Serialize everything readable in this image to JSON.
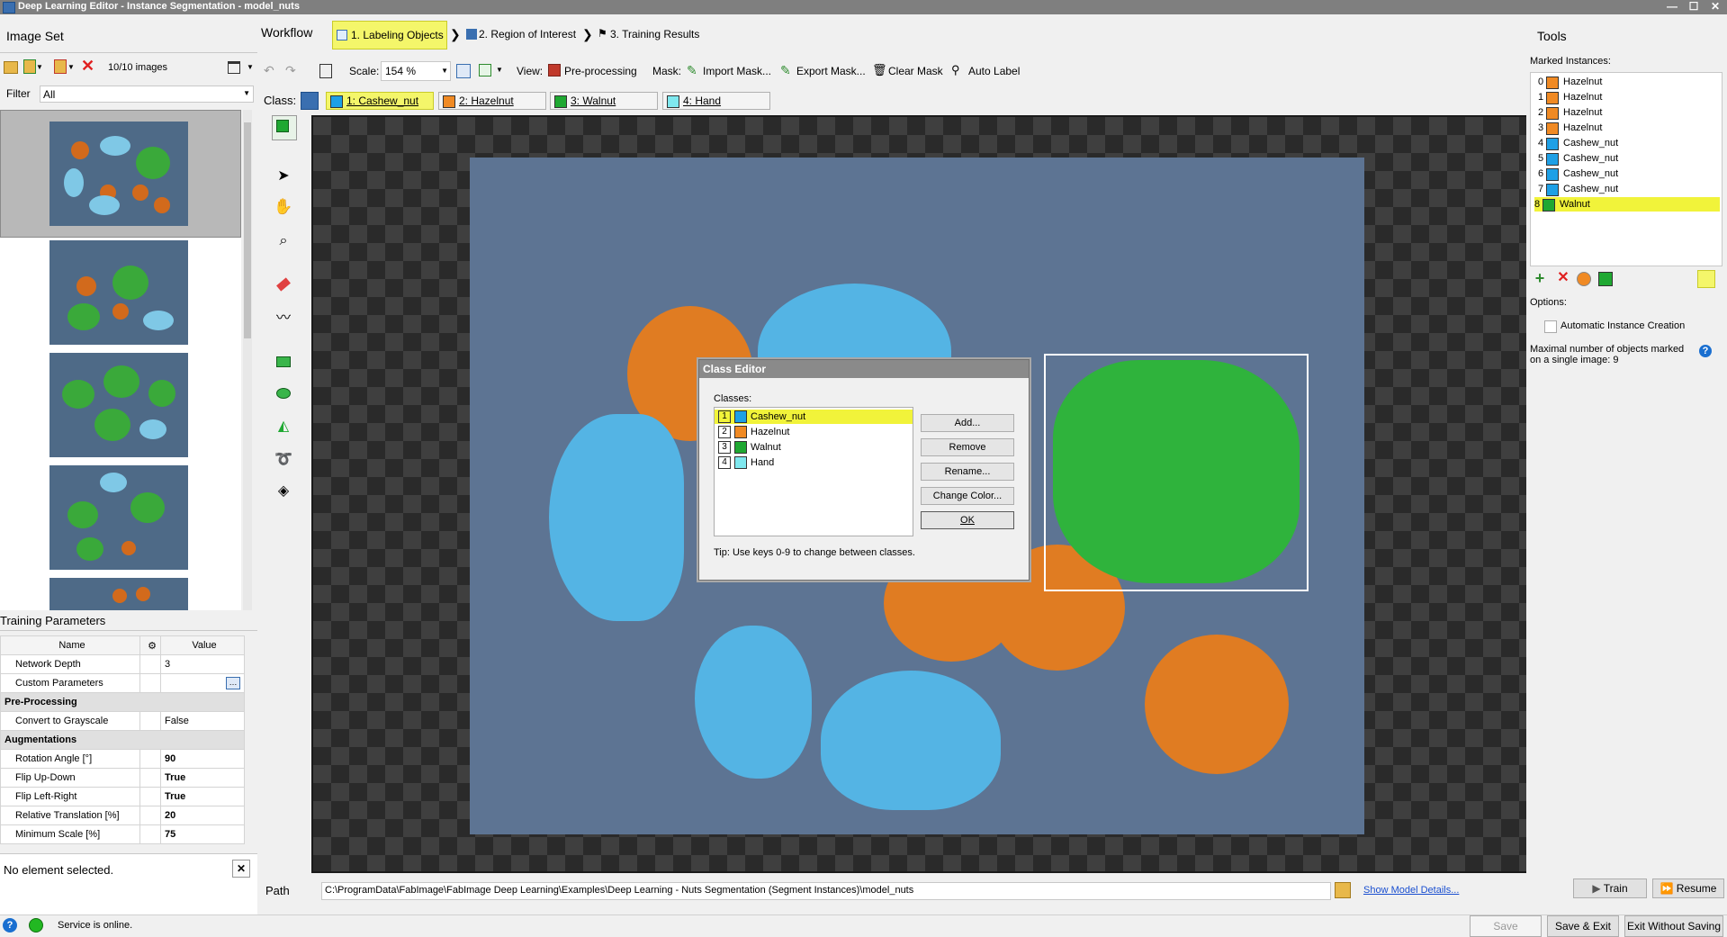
{
  "window": {
    "title": "Deep Learning Editor - Instance Segmentation - model_nuts",
    "minimize": "—",
    "maximize": "☐",
    "close": "✕"
  },
  "image_set": {
    "title": "Image Set",
    "count_text": "10/10 images",
    "filter_label": "Filter",
    "filter_value": "All"
  },
  "workflow": {
    "label": "Workflow",
    "steps": [
      "1. Labeling Objects",
      "2. Region of Interest",
      "3. Training Results"
    ]
  },
  "toolbar": {
    "scale_label": "Scale:",
    "scale_value": "154 %",
    "view_label": "View:",
    "preprocessing": "Pre-processing",
    "mask_label": "Mask:",
    "import_mask": "Import Mask...",
    "export_mask": "Export Mask...",
    "clear_mask": "Clear Mask",
    "auto_label": "Auto Label"
  },
  "class_bar": {
    "label": "Class:",
    "classes": [
      {
        "label": "1: Cashew_nut",
        "color": "#1ea0e6"
      },
      {
        "label": "2: Hazelnut",
        "color": "#f08a24"
      },
      {
        "label": "3: Walnut",
        "color": "#1fa832"
      },
      {
        "label": "4: Hand",
        "color": "#7fe8ef"
      }
    ]
  },
  "training_parameters": {
    "title": "Training Parameters",
    "header_name": "Name",
    "header_value": "Value",
    "rows": [
      {
        "name": "Network Depth",
        "value": "3"
      },
      {
        "name": "Custom Parameters",
        "value": ""
      },
      {
        "section": "Pre-Processing"
      },
      {
        "name": "Convert to Grayscale",
        "value": "False"
      },
      {
        "section": "Augmentations"
      },
      {
        "name": "Rotation Angle [°]",
        "value": "90"
      },
      {
        "name": "Flip Up-Down",
        "value": "True"
      },
      {
        "name": "Flip Left-Right",
        "value": "True"
      },
      {
        "name": "Relative Translation [%]",
        "value": "20"
      },
      {
        "name": "Minimum Scale [%]",
        "value": "75"
      }
    ]
  },
  "selection_status": "No element selected.",
  "path": {
    "label": "Path",
    "value": "C:\\ProgramData\\FabImage\\FabImage Deep Learning\\Examples\\Deep Learning - Nuts Segmentation (Segment Instances)\\model_nuts",
    "show_details": "Show Model Details..."
  },
  "class_editor": {
    "title": "Class Editor",
    "classes_label": "Classes:",
    "classes": [
      {
        "num": "1",
        "label": "Cashew_nut",
        "color": "#1ea0e6"
      },
      {
        "num": "2",
        "label": "Hazelnut",
        "color": "#f08a24"
      },
      {
        "num": "3",
        "label": "Walnut",
        "color": "#1fa832"
      },
      {
        "num": "4",
        "label": "Hand",
        "color": "#7fe8ef"
      }
    ],
    "buttons": {
      "add": "Add...",
      "remove": "Remove",
      "rename": "Rename...",
      "change_color": "Change Color...",
      "ok": "OK"
    },
    "tip": "Tip: Use keys 0-9 to change between classes."
  },
  "tools": {
    "title": "Tools",
    "marked_instances_label": "Marked Instances:",
    "instances": [
      {
        "num": "0",
        "label": "Hazelnut",
        "color": "#f08a24"
      },
      {
        "num": "1",
        "label": "Hazelnut",
        "color": "#f08a24"
      },
      {
        "num": "2",
        "label": "Hazelnut",
        "color": "#f08a24"
      },
      {
        "num": "3",
        "label": "Hazelnut",
        "color": "#f08a24"
      },
      {
        "num": "4",
        "label": "Cashew_nut",
        "color": "#1ea0e6"
      },
      {
        "num": "5",
        "label": "Cashew_nut",
        "color": "#1ea0e6"
      },
      {
        "num": "6",
        "label": "Cashew_nut",
        "color": "#1ea0e6"
      },
      {
        "num": "7",
        "label": "Cashew_nut",
        "color": "#1ea0e6"
      },
      {
        "num": "8",
        "label": "Walnut",
        "color": "#1fa832"
      }
    ],
    "options_label": "Options:",
    "auto_instance": "Automatic Instance Creation",
    "max_objects": "Maximal number of objects marked on a single image: 9",
    "train": "Train",
    "resume": "Resume"
  },
  "status": {
    "service": "Service is online.",
    "save": "Save",
    "save_exit": "Save & Exit",
    "exit_without": "Exit Without Saving"
  },
  "colors": {
    "accent_yellow": "#f1f33a",
    "highlight": "#e8ef1a"
  }
}
